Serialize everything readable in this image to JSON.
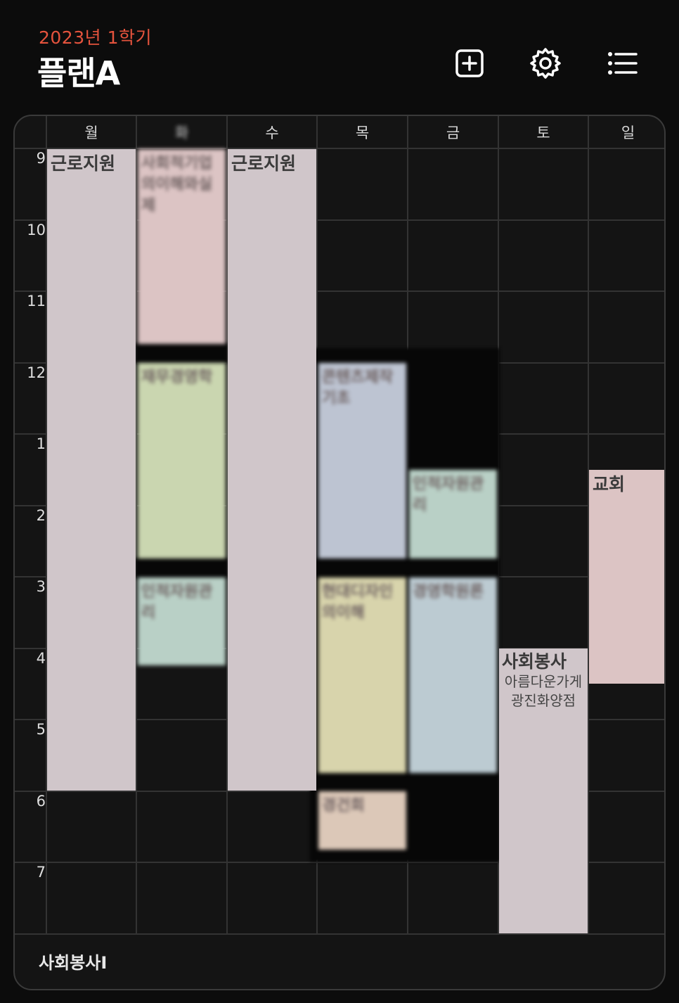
{
  "header": {
    "semester": "2023년 1학기",
    "plan_name": "플랜A",
    "icons": [
      "plus-square-icon",
      "gear-icon",
      "list-icon"
    ]
  },
  "days": [
    "월",
    "화",
    "수",
    "목",
    "금",
    "토",
    "일"
  ],
  "hours": [
    "9",
    "10",
    "11",
    "12",
    "1",
    "2",
    "3",
    "4",
    "5",
    "6",
    "7"
  ],
  "colors": {
    "accent": "#e5533d",
    "mauve": "#d0c6ca",
    "pink": "#dcc4c4",
    "green": "#cad6b0",
    "mint": "#b9d0c6",
    "blue": "#bdc4d2",
    "yellow": "#d8d4ac",
    "steel": "#bccbd2",
    "peach": "#dcc8b8"
  },
  "courses": {
    "mon_work": {
      "title": "근로지원"
    },
    "wed_work": {
      "title": "근로지원"
    },
    "tue_1": {
      "title": "사회적기업의이해와실제"
    },
    "tue_2": {
      "title": "재무경영학"
    },
    "tue_3": {
      "title": "인적자원관리"
    },
    "thu_1": {
      "title": "콘텐츠제작기초"
    },
    "thu_2": {
      "title": "현대디자인의이해"
    },
    "thu_3": {
      "title": "경건회"
    },
    "fri_1": {
      "title": "인적자원관리"
    },
    "fri_2": {
      "title": "경영학원론"
    },
    "sat_volunteer": {
      "title": "사회봉사",
      "place_line1": "아름다운가게",
      "place_line2": "광진화양점"
    },
    "sun_church": {
      "title": "교회"
    }
  },
  "footer": {
    "unscheduled": "사회봉사I"
  }
}
